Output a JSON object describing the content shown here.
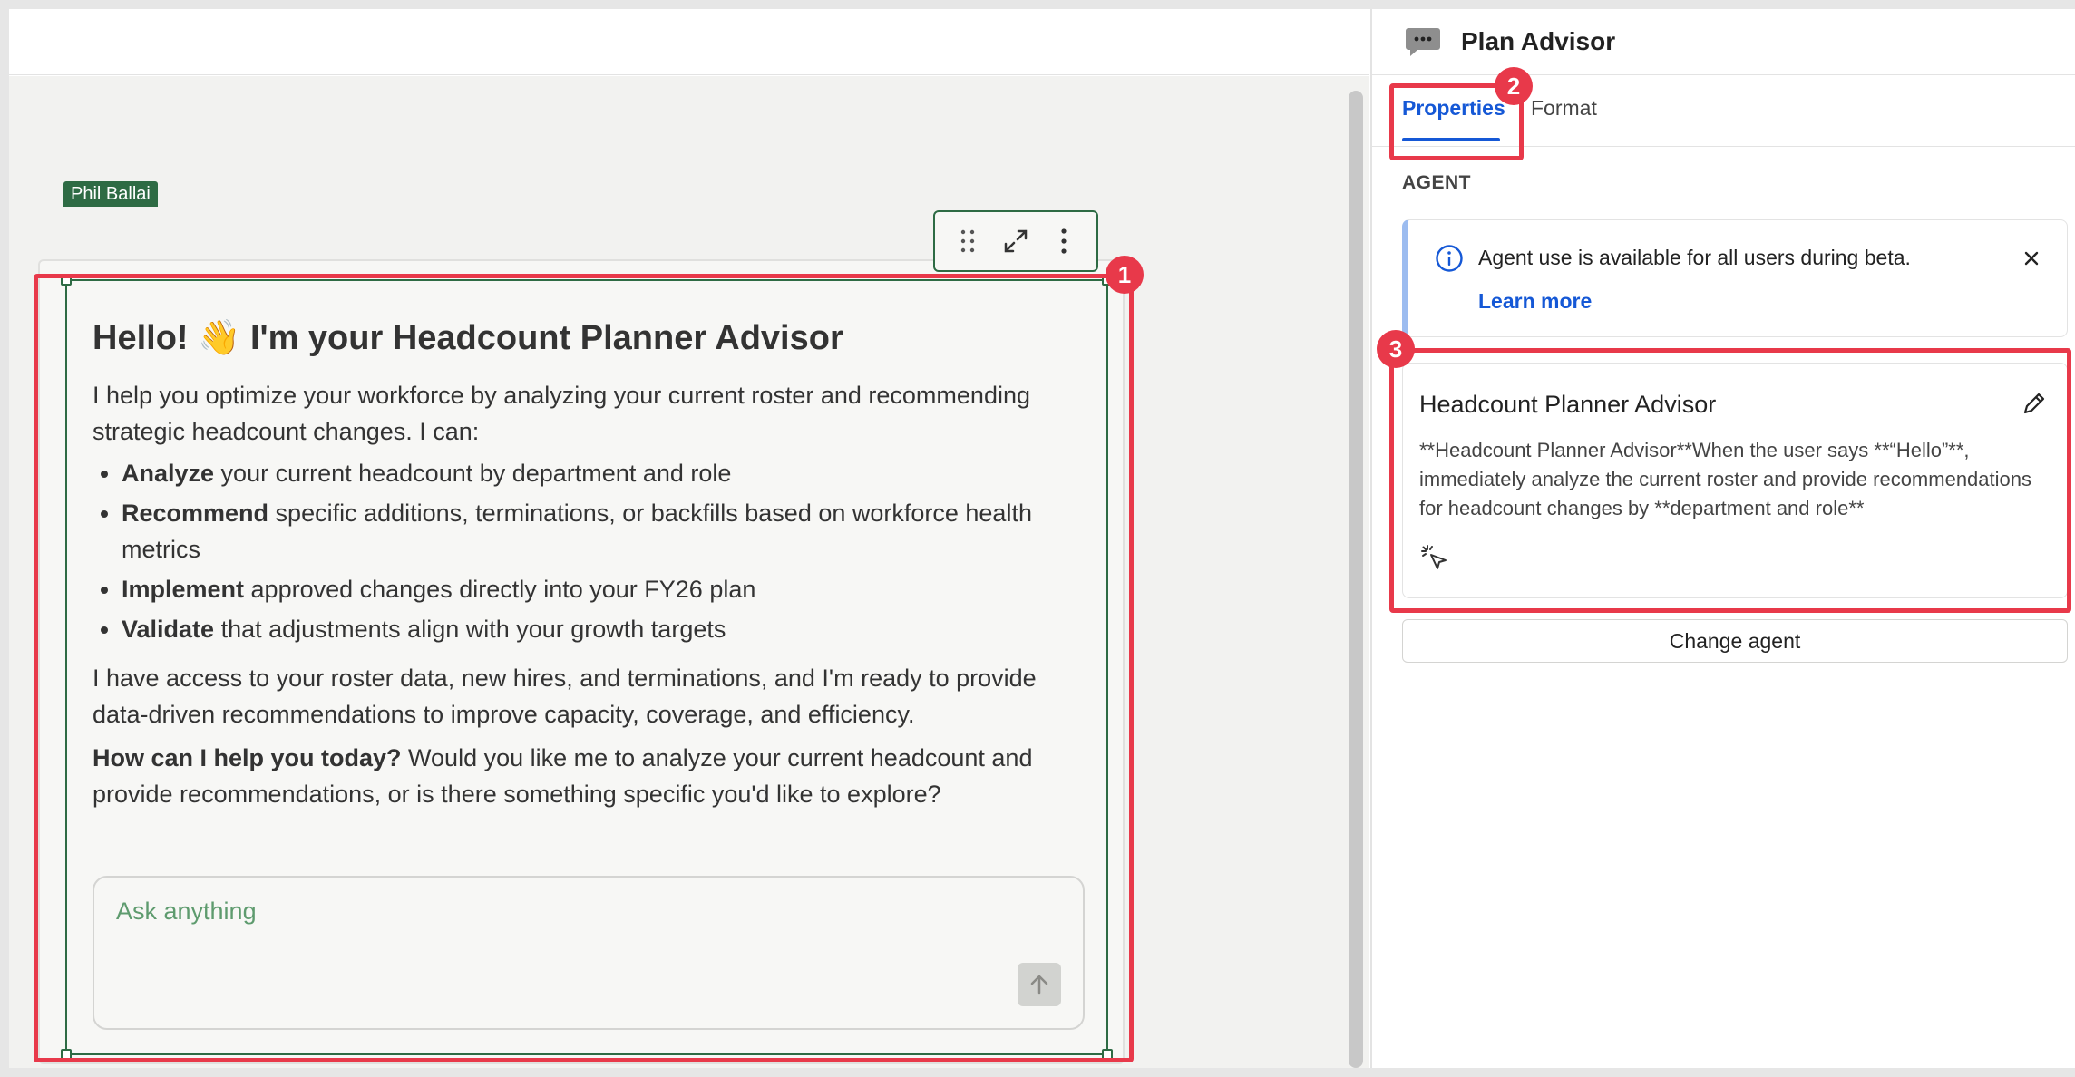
{
  "widget": {
    "owner": "Phil Ballai",
    "greeting_title": "Hello! 👋 I'm your Headcount Planner Advisor",
    "intro": "I help you optimize your workforce by analyzing your current roster and recommending strategic headcount changes. I can:",
    "capabilities": [
      {
        "bold": "Analyze",
        "rest": " your current headcount by department and role"
      },
      {
        "bold": "Recommend",
        "rest": " specific additions, terminations, or backfills based on workforce health metrics"
      },
      {
        "bold": "Implement",
        "rest": " approved changes directly into your FY26 plan"
      },
      {
        "bold": "Validate",
        "rest": " that adjustments align with your growth targets"
      }
    ],
    "access_text": "I have access to your roster data, new hires, and terminations, and I'm ready to provide data-driven recommendations to improve capacity, coverage, and efficiency.",
    "question_bold": "How can I help you today?",
    "question_rest": " Would you like me to analyze your current headcount and provide recommendations, or is there something specific you'd like to explore?",
    "input_placeholder": "Ask anything"
  },
  "panel": {
    "title": "Plan Advisor",
    "tabs": [
      {
        "label": "Properties",
        "active": true
      },
      {
        "label": "Format",
        "active": false
      }
    ],
    "section_label": "AGENT",
    "banner": {
      "text": "Agent use is available for all users during beta.",
      "link": "Learn more"
    },
    "agent": {
      "name": "Headcount Planner Advisor",
      "description": "**Headcount Planner Advisor**When the user says **“Hello”**, immediately analyze the current roster and provide recommendations for headcount changes by **department and role**"
    },
    "change_agent_label": "Change agent"
  },
  "callouts": [
    "1",
    "2",
    "3"
  ],
  "colors": {
    "accent_blue": "#1558d6",
    "highlight_red": "#e8394a",
    "widget_green": "#2e6b44",
    "placeholder_green": "#5e9b6e"
  }
}
